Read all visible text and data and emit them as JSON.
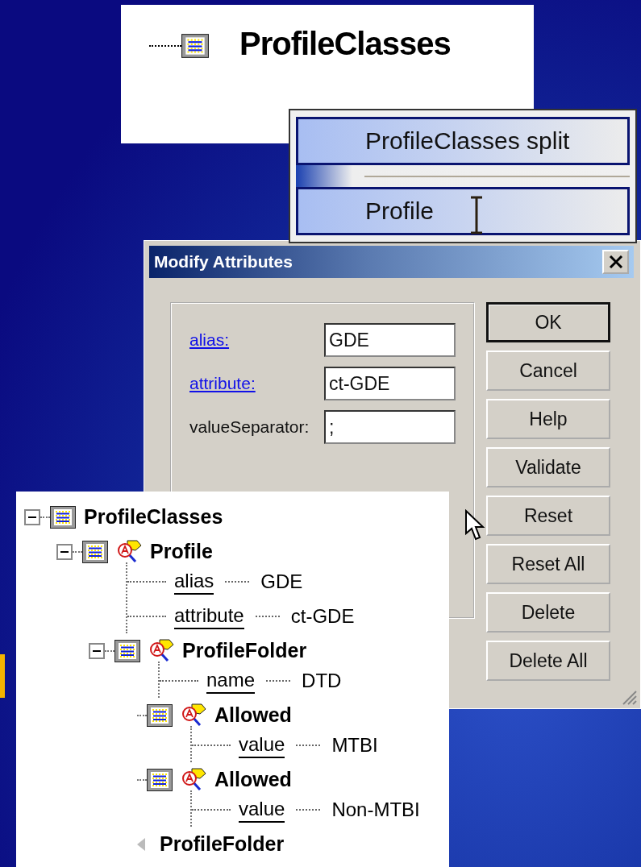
{
  "top_panel": {
    "label": "ProfileClasses"
  },
  "context_menu": {
    "items": [
      {
        "kind": "item",
        "label": "ProfileClasses split",
        "selected": true
      },
      {
        "kind": "separator"
      },
      {
        "kind": "item",
        "label": "Profile",
        "selected": true
      }
    ]
  },
  "dialog": {
    "title": "Modify Attributes",
    "fields": [
      {
        "kind": "link",
        "label": "alias:",
        "value": "GDE"
      },
      {
        "kind": "link",
        "label": "attribute:",
        "value": "ct-GDE"
      },
      {
        "kind": "plain",
        "label": "valueSeparator:",
        "value": ";"
      }
    ],
    "buttons": [
      {
        "label": "OK",
        "default": true
      },
      {
        "label": "Cancel",
        "default": false
      },
      {
        "label": "Help",
        "default": false
      },
      {
        "label": "Validate",
        "default": false
      },
      {
        "label": "Reset",
        "default": false
      },
      {
        "label": "Reset All",
        "default": false
      },
      {
        "label": "Delete",
        "default": false
      },
      {
        "label": "Delete All",
        "default": false
      }
    ]
  },
  "tree": {
    "nodes": [
      {
        "kind": "class",
        "label": "ProfileClasses",
        "tagged": false,
        "expanded": true,
        "children": [
          {
            "kind": "class",
            "label": "Profile",
            "tagged": true,
            "expanded": true,
            "attributes": [
              {
                "name": "alias",
                "value": "GDE"
              },
              {
                "name": "attribute",
                "value": "ct-GDE"
              }
            ],
            "children": [
              {
                "kind": "class",
                "label": "ProfileFolder",
                "tagged": true,
                "expanded": true,
                "attributes": [
                  {
                    "name": "name",
                    "value": "DTD"
                  }
                ],
                "children": [
                  {
                    "kind": "class",
                    "label": "Allowed",
                    "tagged": true,
                    "attributes": [
                      {
                        "name": "value",
                        "value": "MTBI"
                      }
                    ]
                  },
                  {
                    "kind": "class",
                    "label": "Allowed",
                    "tagged": true,
                    "attributes": [
                      {
                        "name": "value",
                        "value": "Non-MTBI"
                      }
                    ]
                  },
                  {
                    "kind": "insert",
                    "label": "ProfileFolder"
                  }
                ]
              }
            ]
          }
        ]
      }
    ]
  }
}
